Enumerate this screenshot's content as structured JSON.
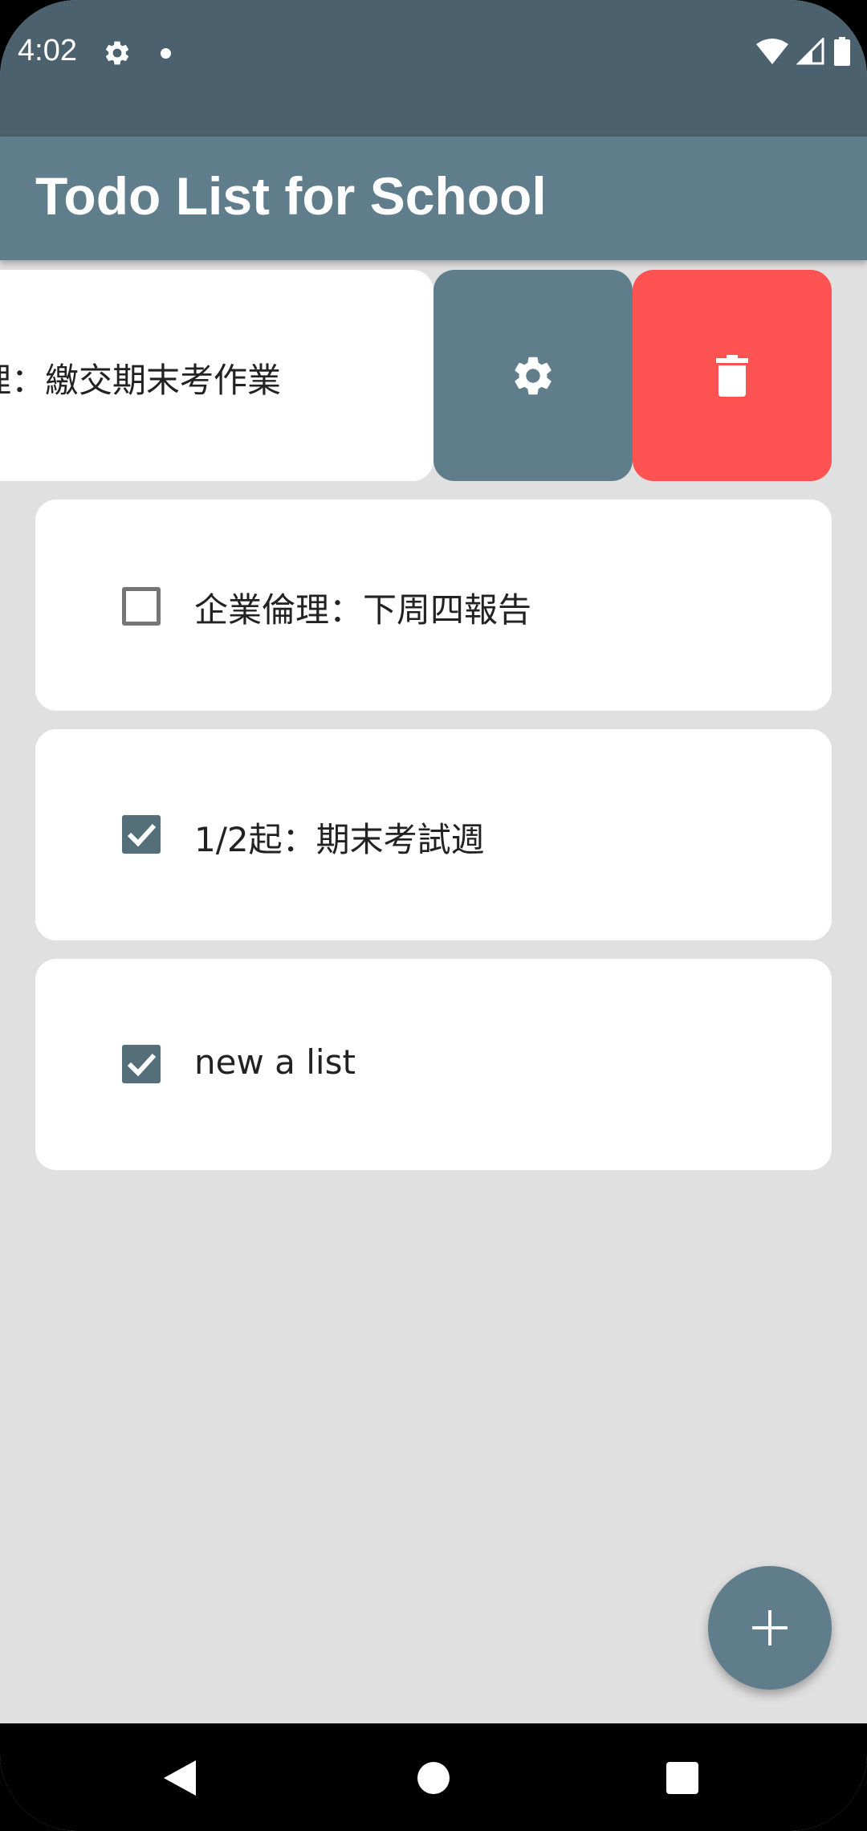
{
  "status_bar": {
    "time": "4:02",
    "icons": [
      "settings-icon",
      "notification-dot-icon",
      "wifi-icon",
      "cell-signal-icon",
      "battery-icon"
    ]
  },
  "app_bar": {
    "title": "Todo List for School"
  },
  "todos": [
    {
      "label": "理：繳交期末考作業",
      "checked": null,
      "swiped_open": true
    },
    {
      "label": "企業倫理：下周四報告",
      "checked": false
    },
    {
      "label": "1/2起：期末考試週",
      "checked": true
    },
    {
      "label": "new a list",
      "checked": true
    }
  ],
  "swipe_actions": {
    "edit_icon": "gear-icon",
    "delete_icon": "trash-icon"
  },
  "fab": {
    "icon": "plus-icon"
  },
  "nav_bar": {
    "icons": [
      "back-icon",
      "home-icon",
      "recents-icon"
    ]
  },
  "colors": {
    "status_bar": "#4b616d",
    "app_bar": "#607d8b",
    "background": "#e0e0e0",
    "card": "#ffffff",
    "checkbox_checked": "#546e7a",
    "delete_action": "#ff5252"
  }
}
